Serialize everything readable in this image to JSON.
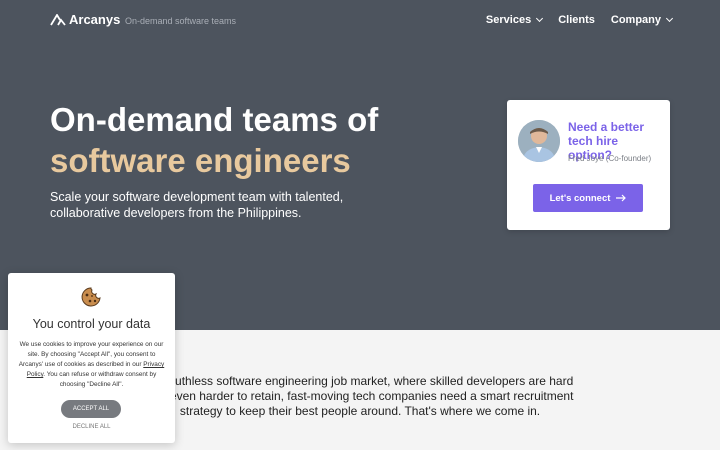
{
  "header": {
    "brand": "Arcanys",
    "tagline": "On-demand software teams",
    "nav": [
      {
        "label": "Services",
        "has_dropdown": true
      },
      {
        "label": "Clients",
        "has_dropdown": false
      },
      {
        "label": "Company",
        "has_dropdown": true
      }
    ]
  },
  "hero": {
    "headline_line1": "On-demand teams of",
    "headline_line2": "software engineers",
    "subheading": "Scale your software development team with talented, collaborative developers from the Philippines."
  },
  "contact_card": {
    "title": "Need a better tech hire option?",
    "person": "Fred Joye (Co-founder)",
    "button_label": "Let's connect"
  },
  "intro": {
    "text": "ay's ruthless software engineering job market, where skilled developers are hard and even harder to retain, fast-moving tech companies need a smart recruitment strategy to keep their best people around. That's where we come in."
  },
  "cookie_banner": {
    "title": "You control your data",
    "body_before_link": "We use cookies to improve your experience on our site. By choosing \"Accept All\", you consent to Arcanys' use of cookies as described in our ",
    "link_label": "Privacy Policy",
    "body_after_link": ". You can refuse or withdraw consent by choosing \"Decline All\".",
    "accept_label": "ACCEPT ALL",
    "decline_label": "DECLINE ALL"
  },
  "colors": {
    "hero_bg": "#4d545e",
    "accent_gold": "#e8c99e",
    "accent_purple": "#7b63e8"
  }
}
